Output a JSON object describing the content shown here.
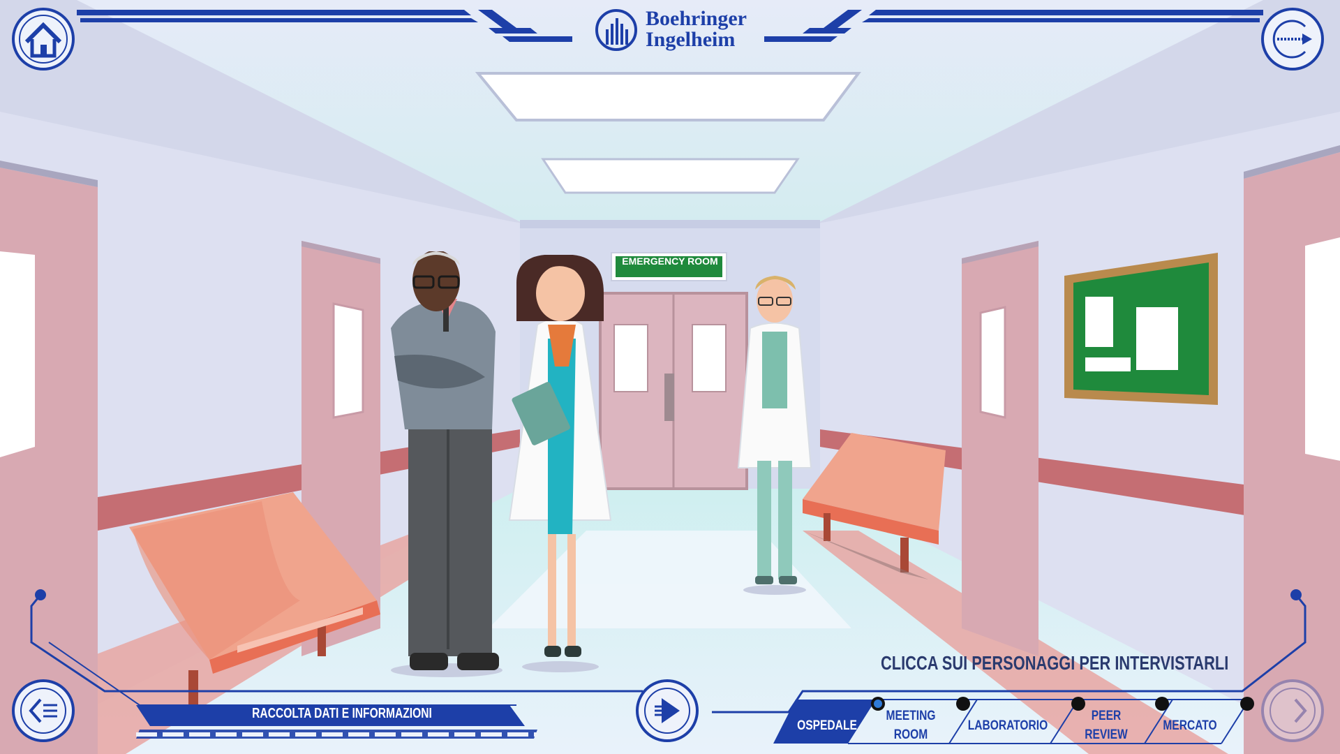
{
  "brand": {
    "line1": "Boehringer",
    "line2": "Ingelheim"
  },
  "scene": {
    "sign": "EMERGENCY ROOM",
    "prompt": "CLICCA SUI PERSONAGGI PER INTERVISTARLI"
  },
  "hud": {
    "section_title": "RACCOLTA DATI E INFORMAZIONI",
    "nav": [
      {
        "label": "OSPEDALE",
        "active": true
      },
      {
        "label": "MEETING\nROOM",
        "active": false
      },
      {
        "label": "LABORATORIO",
        "active": false
      },
      {
        "label": "PEER\nREVIEW",
        "active": false
      },
      {
        "label": "MERCATO",
        "active": false
      }
    ]
  },
  "colors": {
    "accent": "#1d3fa8",
    "wall": "#dcdff0",
    "door": "#dba8b0",
    "bench": "#e86f55",
    "board": "#1f8a3c"
  }
}
